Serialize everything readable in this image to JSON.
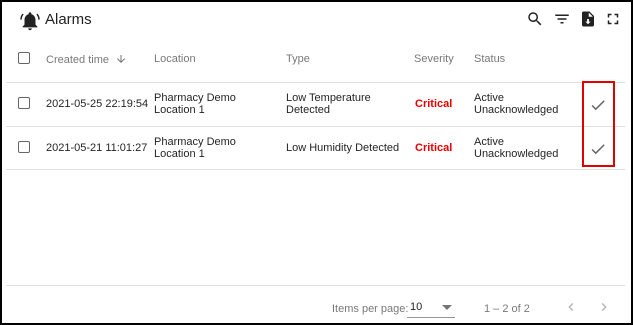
{
  "header": {
    "title": "Alarms",
    "icons": [
      "alarm-bell-icon",
      "search-icon",
      "filter-icon",
      "export-icon",
      "fullscreen-icon"
    ]
  },
  "columns": {
    "created_time": "Created time",
    "location": "Location",
    "type": "Type",
    "severity": "Severity",
    "status": "Status"
  },
  "rows": [
    {
      "created_time": "2021-05-25 22:19:54",
      "location_line1": "Pharmacy Demo",
      "location_line2": "Location 1",
      "type_line1": "Low Temperature",
      "type_line2": "Detected",
      "severity": "Critical",
      "status_line1": "Active",
      "status_line2": "Unacknowledged"
    },
    {
      "created_time": "2021-05-21 11:01:27",
      "location_line1": "Pharmacy Demo",
      "location_line2": "Location 1",
      "type_line1": "Low Humidity Detected",
      "type_line2": "",
      "severity": "Critical",
      "status_line1": "Active",
      "status_line2": "Unacknowledged"
    }
  ],
  "footer": {
    "items_per_page_label": "Items per page:",
    "items_per_page_value": "10",
    "range": "1 – 2 of 2"
  },
  "colors": {
    "critical": "#e60000",
    "highlight_box": "#e00000"
  }
}
